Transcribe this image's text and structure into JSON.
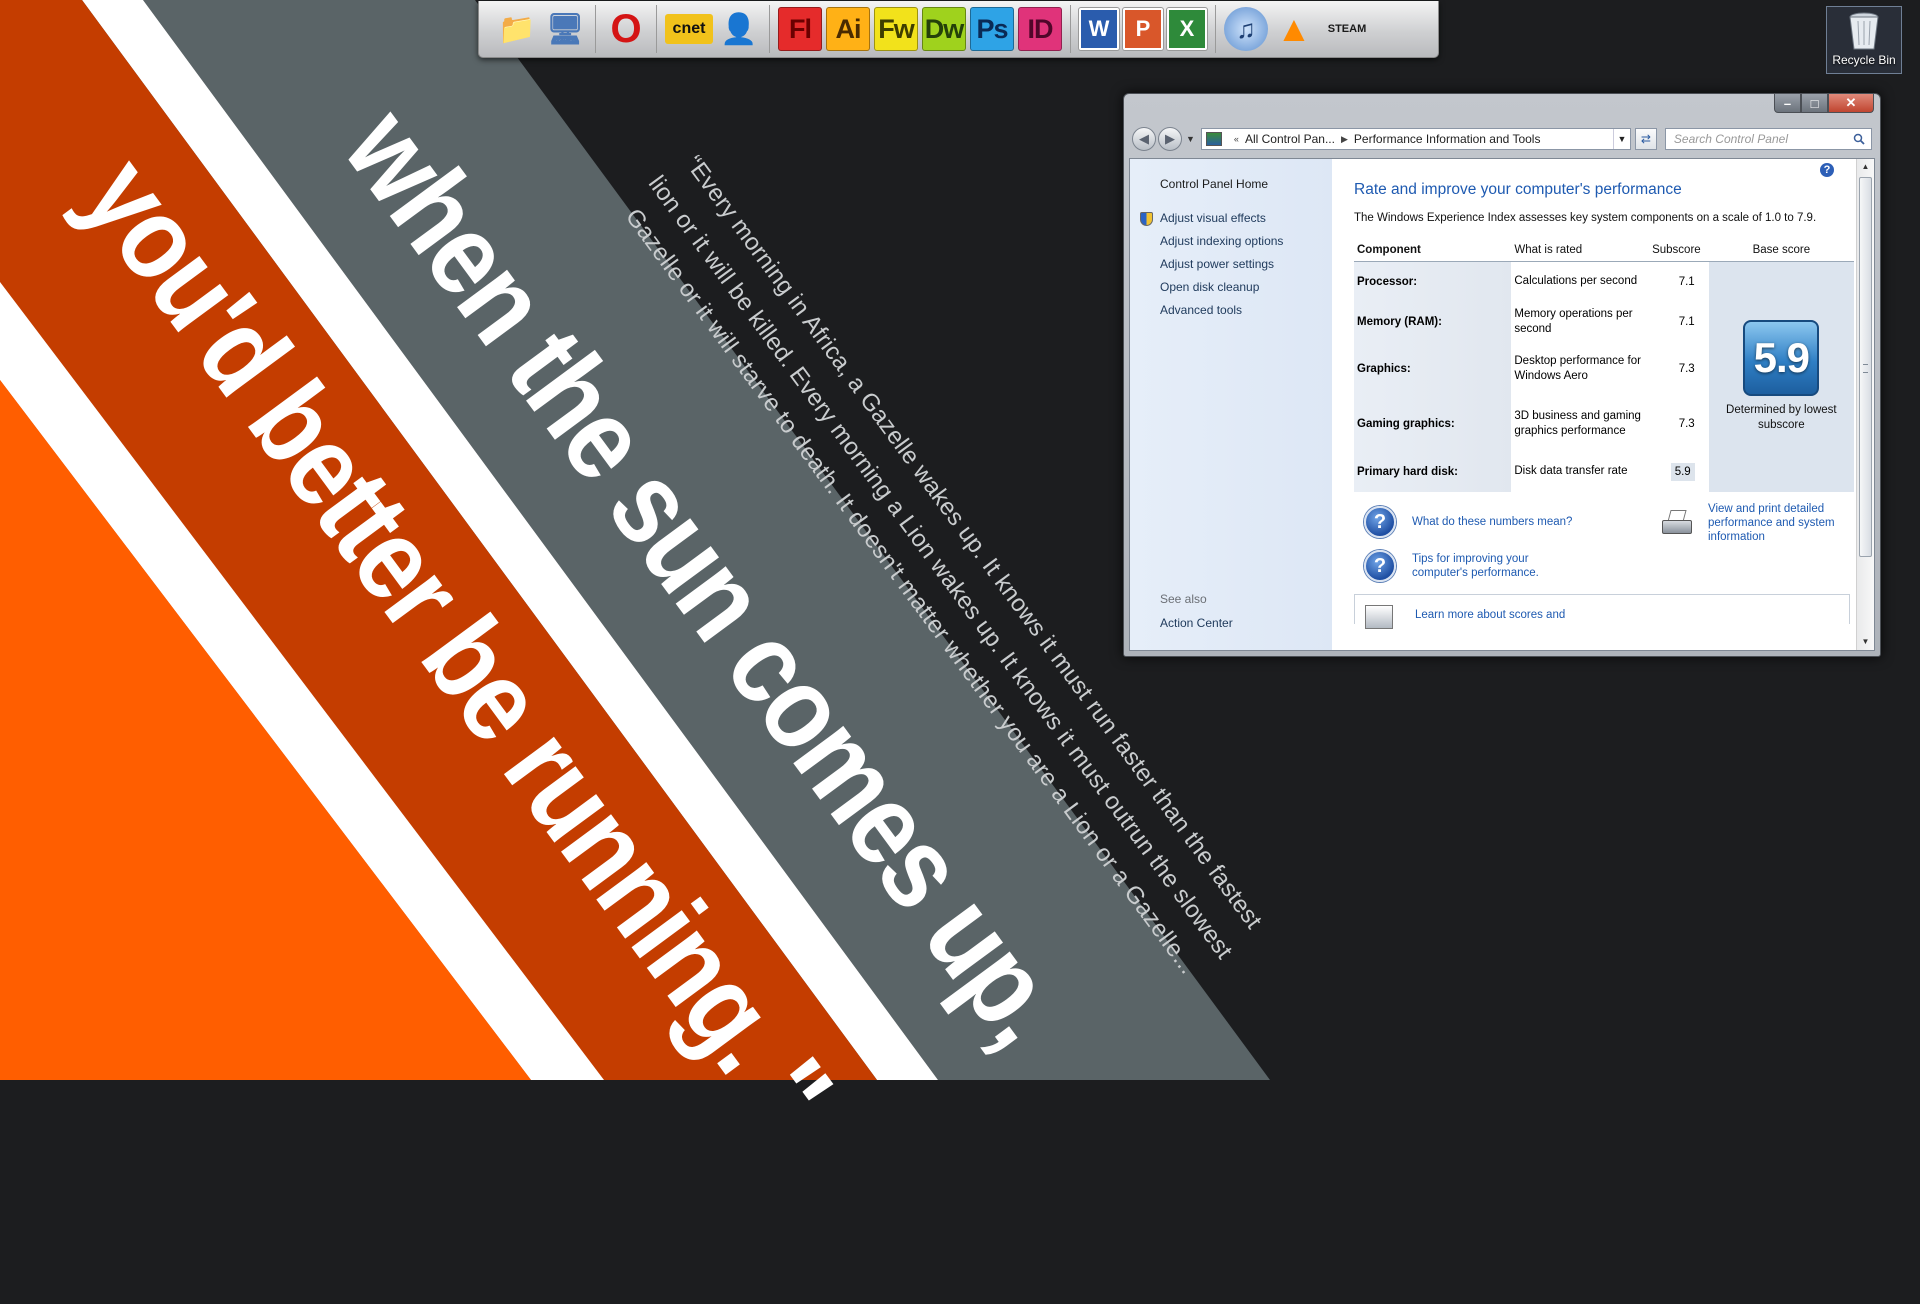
{
  "wallpaper": {
    "colors": {
      "background": "#1c1d1f",
      "stripe_gray": "#5a6467",
      "stripe_dark_orange": "#c43d00",
      "stripe_orange": "#ff5e00",
      "divider_white": "#ffffff",
      "quote_text": "#c9ccce"
    },
    "headline_line1": "when the sun comes up,",
    "headline_line2": "you'd better be running. \"",
    "quote_lines": [
      "“Every morning in Africa, a Gazelle wakes up. It knows it must run faster than the fastest",
      "lion or it will be killed. Every morning a Lion wakes up. It knows it must outrun the slowest",
      "Gazelle or it will starve to death. It doesn't matter whether you are a Lion or a Gazelle..."
    ]
  },
  "dock": {
    "groups": [
      [
        {
          "name": "user-folder-icon",
          "glyph": "📁",
          "color": "#e7b53c"
        },
        {
          "name": "computer-icon",
          "glyph": "🖥",
          "color": "#4a78b8"
        }
      ],
      [
        {
          "name": "opera-icon",
          "glyph": "O",
          "color": "#d41414"
        }
      ],
      [
        {
          "name": "cnet-icon",
          "glyph": "cnet",
          "color": "#f1c21b"
        },
        {
          "name": "messenger-icon",
          "glyph": "👤",
          "color": "#3fae3f"
        }
      ],
      [
        {
          "name": "flash-icon",
          "glyph": "Fl",
          "color": "#e52b2b",
          "text": "#6b0000"
        },
        {
          "name": "illustrator-icon",
          "glyph": "Ai",
          "color": "#ffb116",
          "text": "#4a2a00"
        },
        {
          "name": "fireworks-icon",
          "glyph": "Fw",
          "color": "#f2e21b",
          "text": "#3f3d00"
        },
        {
          "name": "dreamweaver-icon",
          "glyph": "Dw",
          "color": "#9fd21d",
          "text": "#24400a"
        },
        {
          "name": "photoshop-icon",
          "glyph": "Ps",
          "color": "#2ea3e6",
          "text": "#0a2a55"
        },
        {
          "name": "indesign-icon",
          "glyph": "ID",
          "color": "#e0337a",
          "text": "#50062a"
        }
      ],
      [
        {
          "name": "word-icon",
          "glyph": "W",
          "color": "#2a5cad"
        },
        {
          "name": "powerpoint-icon",
          "glyph": "P",
          "color": "#d9572a"
        },
        {
          "name": "excel-icon",
          "glyph": "X",
          "color": "#2e8a3a"
        }
      ],
      [
        {
          "name": "itunes-icon",
          "glyph": "♫",
          "color": "#5d8fcf"
        },
        {
          "name": "vlc-icon",
          "glyph": "▲",
          "color": "#ff8a00"
        },
        {
          "name": "steam-icon",
          "glyph": "STEAM",
          "color": "#d8d8d8",
          "text": "#1a1a1a"
        }
      ]
    ]
  },
  "recycle_bin": {
    "label": "Recycle Bin"
  },
  "window": {
    "controls": {
      "minimize": "–",
      "maximize": "□",
      "close": "✕"
    },
    "address": {
      "crumb1": "All Control Pan...",
      "crumb2": "Performance Information and Tools"
    },
    "search": {
      "placeholder": "Search Control Panel"
    },
    "left_panel": {
      "home": "Control Panel Home",
      "links": [
        "Adjust visual effects",
        "Adjust indexing options",
        "Adjust power settings",
        "Open disk cleanup",
        "Advanced tools"
      ],
      "see_also": "See also",
      "action_center": "Action Center"
    },
    "main": {
      "title": "Rate and improve your computer's performance",
      "intro": "The Windows Experience Index assesses key system components on a scale of 1.0 to 7.9.",
      "headers": {
        "component": "Component",
        "rated": "What is rated",
        "subscore": "Subscore",
        "base": "Base score"
      },
      "rows": [
        {
          "component": "Processor:",
          "rated": "Calculations per second",
          "subscore": "7.1"
        },
        {
          "component": "Memory (RAM):",
          "rated": "Memory operations per second",
          "subscore": "7.1"
        },
        {
          "component": "Graphics:",
          "rated": "Desktop performance for Windows Aero",
          "subscore": "7.3"
        },
        {
          "component": "Gaming graphics:",
          "rated": "3D business and gaming graphics performance",
          "subscore": "7.3"
        },
        {
          "component": "Primary hard disk:",
          "rated": "Disk data transfer rate",
          "subscore": "5.9"
        }
      ],
      "base_score": "5.9",
      "base_caption": "Determined by lowest subscore",
      "link_numbers": "What do these numbers mean?",
      "link_tips": "Tips for improving your computer's performance.",
      "link_print": "View and print detailed performance and system information",
      "link_learn": "Learn more about scores and"
    }
  }
}
